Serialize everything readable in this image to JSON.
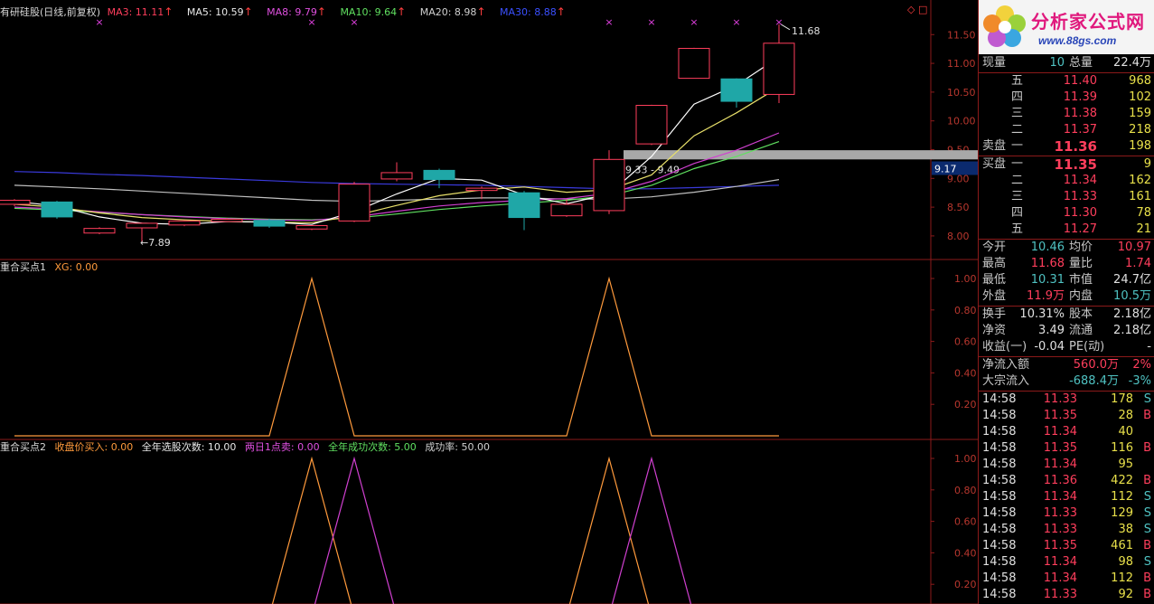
{
  "colors": {
    "up": "#ff3e5c",
    "down": "#1fa7a7",
    "grid": "#8b1a1a",
    "axis_text": "#b8372e",
    "ma3": "#ffffff",
    "ma5": "#e8e06a",
    "ma8": "#d040d0",
    "ma10": "#60e060",
    "ma20": "#c0c0c0",
    "ma30": "#3a3adc",
    "ind1": "#ff9a3c",
    "ind2": "#d040d0"
  },
  "main_legend": {
    "title": "有研硅股(日线,前复权)",
    "ma3": "MA3: 11.11",
    "ma5": "MA5: 10.59",
    "ma8": "MA8: 9.79",
    "ma10": "MA10: 9.64",
    "ma20": "MA20: 8.98",
    "ma30": "MA30: 8.88",
    "arrow": "↑",
    "corner_icons": "◇ □"
  },
  "annotations": {
    "high": "11.68",
    "low": "←7.89",
    "range_label": "9.33 - 9.49",
    "price_tag": "9.17"
  },
  "ind1_legend": {
    "title": "重合买点1",
    "xg": "XG: 0.00"
  },
  "ind2_legend": {
    "title": "重合买点2",
    "item1": "收盘价买入: 0.00",
    "item2": "全年选股次数: 10.00",
    "item3": "两日1点卖: 0.00",
    "item4": "全年成功次数: 5.00",
    "item5": "成功率: 50.00"
  },
  "chart_data": [
    {
      "type": "candlestick",
      "title": "有研硅股(日线,前复权)",
      "y_ticks": [
        "11.50",
        "11.00",
        "10.50",
        "10.00",
        "9.50",
        "9.00",
        "8.50",
        "8.00"
      ],
      "candles": [
        {
          "open": 8.55,
          "close": 8.62,
          "high": 8.64,
          "low": 8.52
        },
        {
          "open": 8.59,
          "close": 8.33,
          "high": 8.61,
          "low": 8.3
        },
        {
          "open": 8.05,
          "close": 8.13,
          "high": 8.15,
          "low": 8.03
        },
        {
          "open": 8.14,
          "close": 8.22,
          "high": 8.23,
          "low": 7.89
        },
        {
          "open": 8.19,
          "close": 8.26,
          "high": 8.27,
          "low": 8.17
        },
        {
          "open": 8.25,
          "close": 8.29,
          "high": 8.31,
          "low": 8.24
        },
        {
          "open": 8.27,
          "close": 8.17,
          "high": 8.3,
          "low": 8.14
        },
        {
          "open": 8.12,
          "close": 8.18,
          "high": 8.19,
          "low": 8.1
        },
        {
          "open": 8.26,
          "close": 8.9,
          "high": 8.94,
          "low": 8.24
        },
        {
          "open": 8.99,
          "close": 9.1,
          "high": 9.28,
          "low": 8.95
        },
        {
          "open": 9.14,
          "close": 8.98,
          "high": 9.17,
          "low": 8.83
        },
        {
          "open": 8.79,
          "close": 8.83,
          "high": 8.86,
          "low": 8.64
        },
        {
          "open": 8.75,
          "close": 8.32,
          "high": 8.78,
          "low": 8.1
        },
        {
          "open": 8.35,
          "close": 8.55,
          "high": 8.64,
          "low": 8.33
        },
        {
          "open": 8.44,
          "close": 9.33,
          "high": 9.49,
          "low": 8.38
        },
        {
          "open": 9.6,
          "close": 10.27,
          "high": 10.28,
          "low": 9.58
        },
        {
          "open": 10.74,
          "close": 11.26,
          "high": 11.27,
          "low": 10.74
        },
        {
          "open": 10.73,
          "close": 10.34,
          "high": 10.74,
          "low": 10.23
        },
        {
          "open": 10.46,
          "close": 11.35,
          "high": 11.68,
          "low": 10.31
        }
      ],
      "series": [
        {
          "name": "MA3",
          "values": [
            8.6,
            8.52,
            8.33,
            8.22,
            8.2,
            8.25,
            8.24,
            8.2,
            8.42,
            8.73,
            9.0,
            8.97,
            8.71,
            8.56,
            8.73,
            9.38,
            10.29,
            10.62,
            11.11
          ]
        },
        {
          "name": "MA5",
          "values": [
            8.55,
            8.5,
            8.4,
            8.32,
            8.28,
            8.25,
            8.24,
            8.23,
            8.35,
            8.53,
            8.7,
            8.8,
            8.85,
            8.76,
            8.8,
            9.06,
            9.74,
            10.14,
            10.59
          ]
        },
        {
          "name": "MA8",
          "values": [
            8.5,
            8.47,
            8.42,
            8.37,
            8.33,
            8.3,
            8.28,
            8.27,
            8.33,
            8.43,
            8.52,
            8.58,
            8.62,
            8.65,
            8.74,
            8.95,
            9.26,
            9.49,
            9.79
          ]
        },
        {
          "name": "MA10",
          "values": [
            8.48,
            8.45,
            8.41,
            8.37,
            8.34,
            8.31,
            8.29,
            8.28,
            8.31,
            8.38,
            8.46,
            8.52,
            8.57,
            8.62,
            8.7,
            8.88,
            9.17,
            9.38,
            9.64
          ]
        },
        {
          "name": "MA20",
          "values": [
            8.88,
            8.85,
            8.82,
            8.78,
            8.74,
            8.7,
            8.66,
            8.62,
            8.6,
            8.62,
            8.64,
            8.66,
            8.66,
            8.64,
            8.64,
            8.68,
            8.76,
            8.86,
            8.98
          ]
        },
        {
          "name": "MA30",
          "values": [
            9.12,
            9.1,
            9.07,
            9.05,
            9.02,
            8.99,
            8.96,
            8.93,
            8.91,
            8.9,
            8.89,
            8.88,
            8.86,
            8.84,
            8.82,
            8.82,
            8.84,
            8.86,
            8.88
          ]
        }
      ]
    },
    {
      "type": "line",
      "title": "重合买点1",
      "y_ticks": [
        "1.00",
        "0.80",
        "0.60",
        "0.40",
        "0.20"
      ],
      "series": [
        {
          "name": "XG",
          "values": [
            0,
            0,
            0,
            0,
            0,
            0,
            0,
            1,
            0,
            0,
            0,
            0,
            0,
            0,
            1,
            0,
            0,
            0,
            0
          ]
        }
      ]
    },
    {
      "type": "line",
      "title": "重合买点2",
      "y_ticks": [
        "1.00",
        "0.80",
        "0.60",
        "0.40",
        "0.20"
      ],
      "series": [
        {
          "name": "收盘价买入",
          "values": [
            0,
            0,
            0,
            0,
            0,
            0,
            0,
            1,
            0,
            0,
            0,
            0,
            0,
            0,
            1,
            0,
            0,
            0,
            0
          ]
        },
        {
          "name": "两日1点卖",
          "values": [
            0,
            0,
            0,
            0,
            0,
            0,
            0,
            0,
            1,
            0,
            0,
            0,
            0,
            0,
            0,
            1,
            0,
            0,
            0
          ]
        }
      ]
    }
  ],
  "logo": {
    "title": "分析家公式网",
    "url": "www.88gs.com"
  },
  "quote": {
    "now_label": "现量",
    "now": "10",
    "total_label": "总量",
    "total": "22.4万",
    "sell_label": "卖盘",
    "buy_label": "买盘",
    "sells": [
      {
        "lvl": "五",
        "price": "11.40",
        "vol": "968"
      },
      {
        "lvl": "四",
        "price": "11.39",
        "vol": "102"
      },
      {
        "lvl": "三",
        "price": "11.38",
        "vol": "159"
      },
      {
        "lvl": "二",
        "price": "11.37",
        "vol": "218"
      },
      {
        "lvl": "一",
        "price": "11.36",
        "vol": "198"
      }
    ],
    "buys": [
      {
        "lvl": "一",
        "price": "11.35",
        "vol": "9"
      },
      {
        "lvl": "二",
        "price": "11.34",
        "vol": "162"
      },
      {
        "lvl": "三",
        "price": "11.33",
        "vol": "161"
      },
      {
        "lvl": "四",
        "price": "11.30",
        "vol": "78"
      },
      {
        "lvl": "五",
        "price": "11.27",
        "vol": "21"
      }
    ],
    "stats": [
      {
        "l1": "今开",
        "v1": "10.46",
        "c1": "cyan",
        "l2": "均价",
        "v2": "10.97",
        "c2": "red"
      },
      {
        "l1": "最高",
        "v1": "11.68",
        "c1": "red",
        "l2": "量比",
        "v2": "1.74",
        "c2": "red"
      },
      {
        "l1": "最低",
        "v1": "10.31",
        "c1": "cyan",
        "l2": "市值",
        "v2": "24.7亿",
        "c2": "white"
      },
      {
        "l1": "外盘",
        "v1": "11.9万",
        "c1": "red",
        "l2": "内盘",
        "v2": "10.5万",
        "c2": "cyan"
      }
    ],
    "stats2": [
      {
        "l1": "换手",
        "v1": "10.31%",
        "l2": "股本",
        "v2": "2.18亿"
      },
      {
        "l1": "净资",
        "v1": "3.49",
        "l2": "流通",
        "v2": "2.18亿"
      },
      {
        "l1": "收益(一)",
        "v1": "-0.04",
        "l2": "PE(动)",
        "v2": "-"
      }
    ],
    "flow": [
      {
        "label": "净流入额",
        "value": "560.0万",
        "pct": "2%",
        "color": "red"
      },
      {
        "label": "大宗流入",
        "value": "-688.4万",
        "pct": "-3%",
        "color": "cyan"
      }
    ]
  },
  "ticks": [
    {
      "time": "14:58",
      "price": "11.33",
      "vol": "178",
      "side": "S",
      "pc": "red",
      "sc": "cyan"
    },
    {
      "time": "14:58",
      "price": "11.35",
      "vol": "28",
      "side": "B",
      "pc": "red",
      "sc": "red"
    },
    {
      "time": "14:58",
      "price": "11.34",
      "vol": "40",
      "side": "",
      "pc": "red",
      "sc": "red"
    },
    {
      "time": "14:58",
      "price": "11.35",
      "vol": "116",
      "side": "B",
      "pc": "red",
      "sc": "red"
    },
    {
      "time": "14:58",
      "price": "11.34",
      "vol": "95",
      "side": "",
      "pc": "red",
      "sc": "red"
    },
    {
      "time": "14:58",
      "price": "11.36",
      "vol": "422",
      "side": "B",
      "pc": "red",
      "sc": "red"
    },
    {
      "time": "14:58",
      "price": "11.34",
      "vol": "112",
      "side": "S",
      "pc": "red",
      "sc": "cyan"
    },
    {
      "time": "14:58",
      "price": "11.33",
      "vol": "129",
      "side": "S",
      "pc": "red",
      "sc": "cyan"
    },
    {
      "time": "14:58",
      "price": "11.33",
      "vol": "38",
      "side": "S",
      "pc": "red",
      "sc": "cyan"
    },
    {
      "time": "14:58",
      "price": "11.35",
      "vol": "461",
      "side": "B",
      "pc": "red",
      "sc": "red"
    },
    {
      "time": "14:58",
      "price": "11.34",
      "vol": "98",
      "side": "S",
      "pc": "red",
      "sc": "cyan"
    },
    {
      "time": "14:58",
      "price": "11.34",
      "vol": "112",
      "side": "B",
      "pc": "red",
      "sc": "red"
    },
    {
      "time": "14:58",
      "price": "11.33",
      "vol": "92",
      "side": "B",
      "pc": "red",
      "sc": "red"
    }
  ]
}
